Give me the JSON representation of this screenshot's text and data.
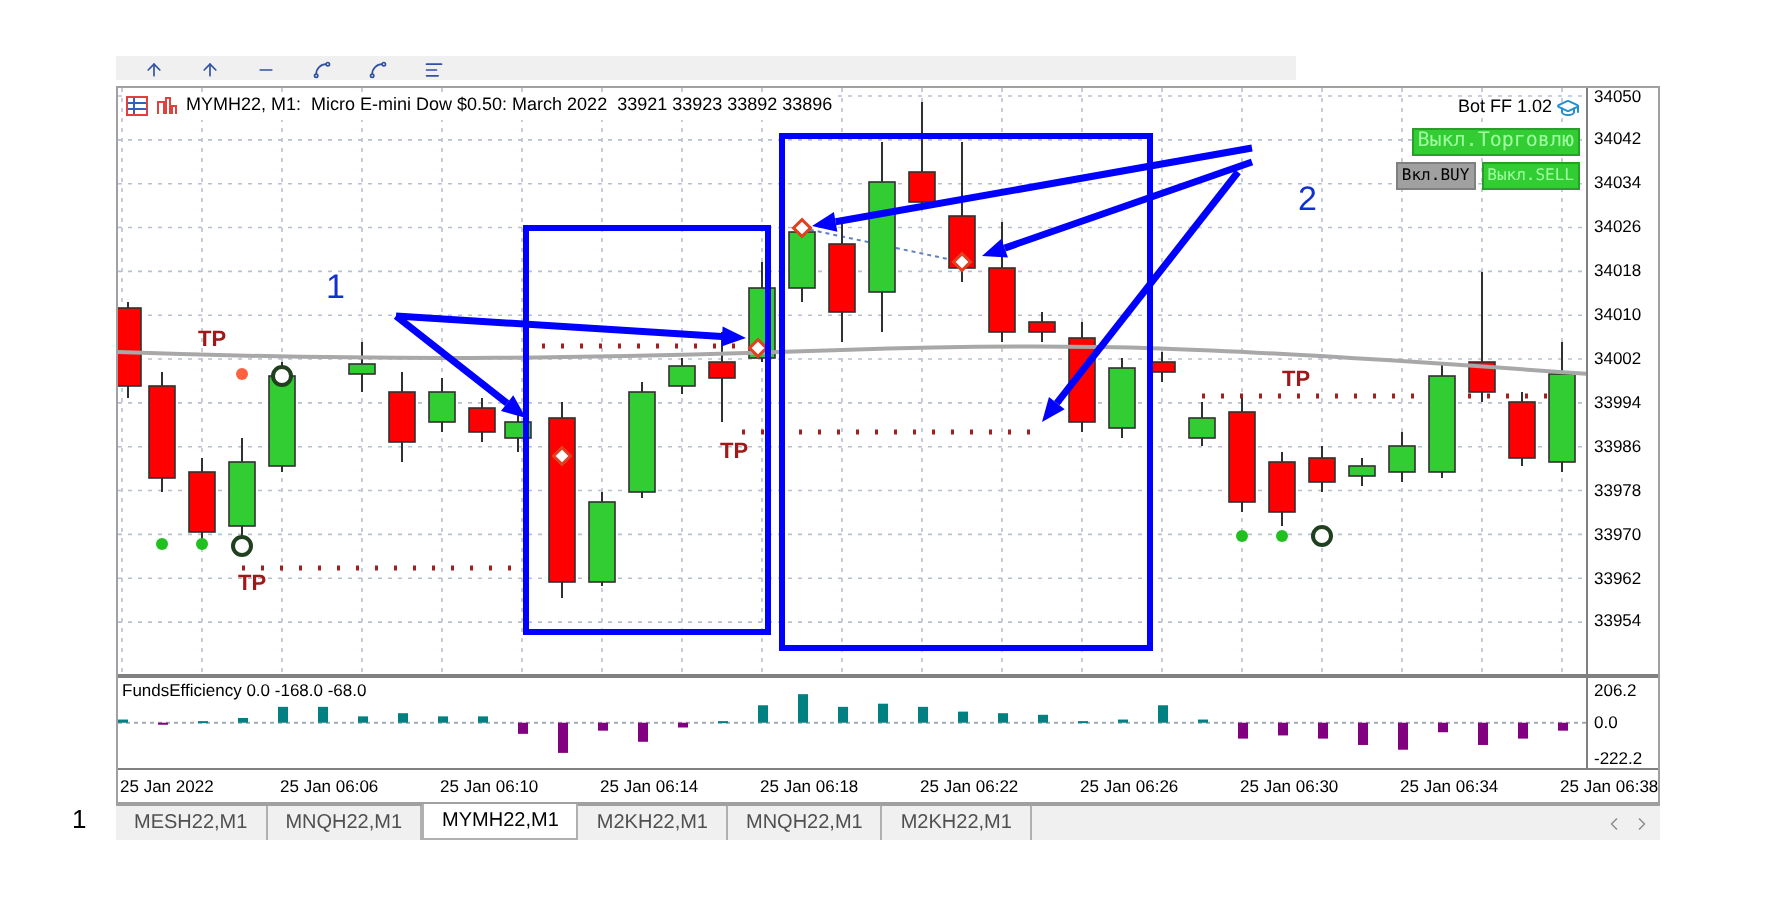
{
  "chart": {
    "header": "MYMH22, M1:  Micro E-mini Dow $0.50: March 2022  33921 33923 33892 33896",
    "bot_label": "Bot FF 1.02",
    "buttons": [
      {
        "label": "Выкл.Торговлю",
        "active": true
      },
      {
        "label": "Вкл.BUY",
        "active": false
      },
      {
        "label": "Выкл.SELL",
        "active": true
      }
    ],
    "price_axis": [
      "34050",
      "34042",
      "34034",
      "34026",
      "34018",
      "34010",
      "34002",
      "33994",
      "33986",
      "33978",
      "33970",
      "33962",
      "33954"
    ],
    "tp_labels": [
      "TP",
      "TP",
      "TP",
      "TP"
    ],
    "annotation_labels": [
      "1",
      "2"
    ]
  },
  "indicator": {
    "title": "FundsEfficiency 0.0 -168.0 -68.0",
    "axis_labels": [
      "206.2",
      "0.0",
      "-222.2"
    ],
    "time_labels": [
      "25 Jan 2022",
      "25 Jan 06:06",
      "25 Jan 06:10",
      "25 Jan 06:14",
      "25 Jan 06:18",
      "25 Jan 06:22",
      "25 Jan 06:26",
      "25 Jan 06:30",
      "25 Jan 06:34",
      "25 Jan 06:38"
    ]
  },
  "tabs": [
    {
      "label": "MESH22,M1",
      "selected": false
    },
    {
      "label": "MNQH22,M1",
      "selected": false
    },
    {
      "label": "MYMH22,M1",
      "selected": true
    },
    {
      "label": "M2KH22,M1",
      "selected": false
    },
    {
      "label": "MNQH22,M1",
      "selected": false
    },
    {
      "label": "M2KH22,M1",
      "selected": false
    }
  ],
  "page_note": "1"
}
